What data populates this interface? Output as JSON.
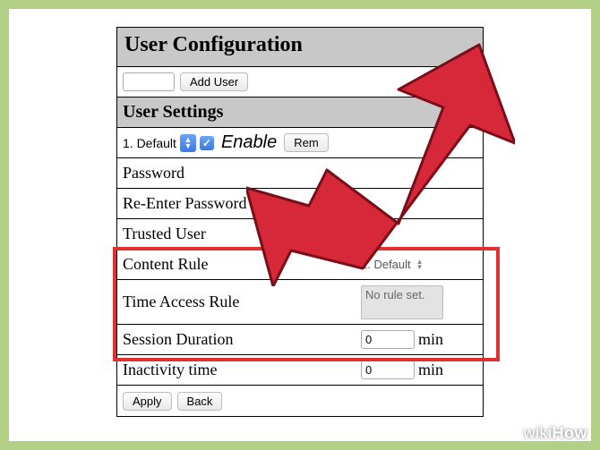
{
  "header": {
    "title": "User Configuration"
  },
  "add_user": {
    "button": "Add User",
    "value": ""
  },
  "user_settings": {
    "heading": "User Settings",
    "index_label": "1. Default",
    "enable_label": "Enable",
    "enable_checked": true,
    "remove_button": "Rem"
  },
  "rows": {
    "password": {
      "label": "Password"
    },
    "repassword": {
      "label": "Re-Enter Password"
    },
    "trusted": {
      "label": "Trusted User"
    },
    "content_rule": {
      "label": "Content Rule",
      "value": "1. Default"
    },
    "time_access": {
      "label": "Time Access Rule",
      "value": "No rule set."
    },
    "session": {
      "label": "Session Duration",
      "value": "0",
      "unit": "min"
    },
    "inactivity": {
      "label": "Inactivity time",
      "value": "0",
      "unit": "min"
    }
  },
  "footer": {
    "apply": "Apply",
    "back": "Back"
  },
  "watermark": {
    "prefix": "wiki",
    "suffix": "How"
  }
}
